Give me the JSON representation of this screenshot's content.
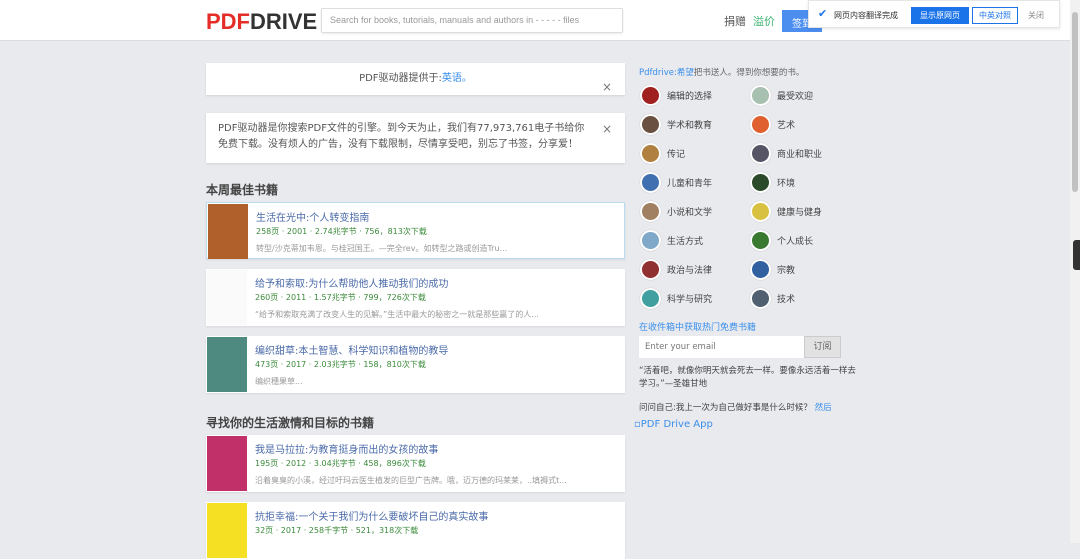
{
  "header": {
    "logo_a": "PDF",
    "logo_b": "DRIVE",
    "search_placeholder": "Search for books, tutorials, manuals and authors in - - - - - files",
    "donate": "捐赠",
    "premium": "溢价",
    "signin": "签到"
  },
  "translate_bar": {
    "message": "网页内容翻译完成",
    "show_original": "显示原网页",
    "bilingual": "中英对照",
    "close": "关闭"
  },
  "notices": {
    "lang_prefix": "PDF驱动器提供于:",
    "lang_link": "英语。",
    "intro": "PDF驱动器是你搜索PDF文件的引擎。到今天为止，我们有77,973,761电子书给你免费下载。没有烦人的广告，没有下载限制，尽情享受吧，别忘了书签，分享爱！",
    "close": "×"
  },
  "sections": [
    {
      "title": "本周最佳书籍",
      "books": [
        {
          "title": "生活在光中:个人转变指南",
          "meta": "258页 · 2001 · 2.74兆字节 · 756，813次下载",
          "desc": "转型/沙克蒂加韦恩。与桂冠国王。—完全rev。如转型之路或创造Tru...",
          "color": "#b0602a"
        },
        {
          "title": "给予和索取:为什么帮助他人推动我们的成功",
          "meta": "260页 · 2011 · 1.57兆字节 · 799，726次下载",
          "desc": "“给予和索取充满了改变人生的见解。”生活中最大的秘密之一就是那些赢了的人...",
          "color": "#fafafa"
        },
        {
          "title": "编织甜草:本土智慧、科学知识和植物的教导",
          "meta": "473页 · 2017 · 2.03兆字节 · 158，810次下载",
          "desc": "编织穗果草...",
          "color": "#4f8a80"
        }
      ]
    },
    {
      "title": "寻找你的生活激情和目标的书籍",
      "books": [
        {
          "title": "我是马拉拉:为教育挺身而出的女孩的故事",
          "meta": "195页 · 2012 · 3.04兆字节 · 458，896次下载",
          "desc": "沿着臭臭的小溪，经过吁玛云医生植发的巨型广告牌。哦，迈万德的玛莱莱，..填褥式t...",
          "color": "#c2306a"
        },
        {
          "title": "抗拒幸福:一个关于我们为什么要破坏自己的真实故事",
          "meta": "32页 · 2017 · 258千字节 · 521，318次下载",
          "desc": "",
          "color": "#f5e024"
        }
      ]
    }
  ],
  "sidebar": {
    "tag_link": "Pdfdrive:希望",
    "tag_rest": "把书送人。得到你想要的书。",
    "categories": [
      {
        "label": "编辑的选择",
        "color": "#a02020"
      },
      {
        "label": "最受欢迎",
        "color": "#a8c0b0"
      },
      {
        "label": "学术和教育",
        "color": "#6a5040"
      },
      {
        "label": "艺术",
        "color": "#e06030"
      },
      {
        "label": "传记",
        "color": "#b08040"
      },
      {
        "label": "商业和职业",
        "color": "#555566"
      },
      {
        "label": "儿童和青年",
        "color": "#4070b0"
      },
      {
        "label": "环境",
        "color": "#2a4a2a"
      },
      {
        "label": "小说和文学",
        "color": "#a08060"
      },
      {
        "label": "健康与健身",
        "color": "#d8c040"
      },
      {
        "label": "生活方式",
        "color": "#80a8c8"
      },
      {
        "label": "个人成长",
        "color": "#3a7a30"
      },
      {
        "label": "政治与法律",
        "color": "#903030"
      },
      {
        "label": "宗教",
        "color": "#3060a0"
      },
      {
        "label": "科学与研究",
        "color": "#40a0a0"
      },
      {
        "label": "技术",
        "color": "#506070"
      }
    ],
    "email_heading": "在收件箱中获取热门免费书籍",
    "email_placeholder": "Enter your email",
    "subscribe": "订阅",
    "quote": "“活着吧，就像你明天就会死去一样。要像永远活着一样去学习。”—圣雄甘地",
    "ask": "问问自己:我上一次为自己做好事是什么时候？",
    "ask_link": "然后",
    "app": "PDF Drive App"
  }
}
